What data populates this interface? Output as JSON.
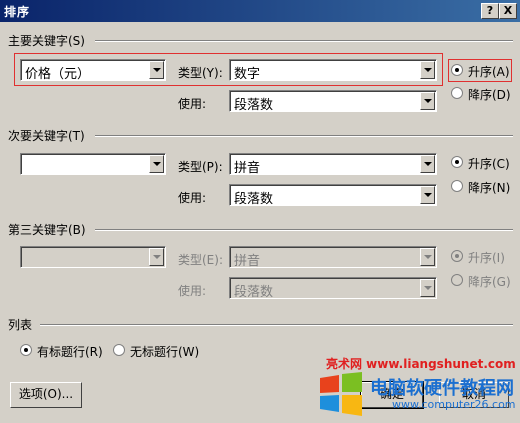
{
  "window": {
    "title": "排序",
    "help_btn": "?",
    "close_btn": "X"
  },
  "primary": {
    "section_label": "主要关键字(S)",
    "key_value": "价格（元）",
    "type_label": "类型(Y):",
    "type_value": "数字",
    "using_label": "使用:",
    "using_value": "段落数",
    "asc_label": "升序(A)",
    "desc_label": "降序(D)"
  },
  "secondary": {
    "section_label": "次要关键字(T)",
    "key_value": "",
    "type_label": "类型(P):",
    "type_value": "拼音",
    "using_label": "使用:",
    "using_value": "段落数",
    "asc_label": "升序(C)",
    "desc_label": "降序(N)"
  },
  "tertiary": {
    "section_label": "第三关键字(B)",
    "key_value": "",
    "type_label": "类型(E):",
    "type_value": "拼音",
    "using_label": "使用:",
    "using_value": "段落数",
    "asc_label": "升序(I)",
    "desc_label": "降序(G)"
  },
  "list": {
    "section_label": "列表",
    "header_row_label": "有标题行(R)",
    "no_header_row_label": "无标题行(W)"
  },
  "buttons": {
    "options": "选项(O)...",
    "ok": "确定",
    "cancel": "取消"
  },
  "watermark": {
    "url1": "亮术网 www.liangshunet.com",
    "name": "电脑软硬件教程网",
    "url2": "www.computer26.com"
  },
  "colors": {
    "title_bar": "#0a246a",
    "highlight": "#e03030",
    "watermark_red": "#e02020",
    "watermark_blue": "#1b6fd0"
  }
}
